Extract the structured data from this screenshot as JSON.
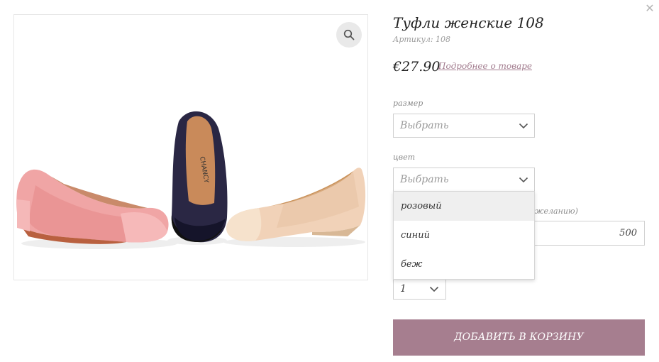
{
  "product": {
    "title": "Туфли женские 108",
    "sku": "Артикул: 108",
    "price": "€27.90",
    "details_link": "Подробнее о товаре"
  },
  "size_field": {
    "label": "размер",
    "value": "Выбрать"
  },
  "color_field": {
    "label": "цвет",
    "value": "Выбрать",
    "options": [
      "розовый",
      "синий",
      "беж"
    ],
    "highlighted_option": "розовый"
  },
  "amount_field": {
    "label_partial": "желанию)",
    "value": "500"
  },
  "quantity": {
    "value": "1"
  },
  "add_to_cart_label": "ДОБАВИТЬ В КОРЗИНУ",
  "icons": {
    "close": "close-icon",
    "zoom": "magnifier-icon",
    "chevron": "chevron-down-icon"
  },
  "colors": {
    "accent": "#a67e8f",
    "link": "#a37d8f"
  }
}
